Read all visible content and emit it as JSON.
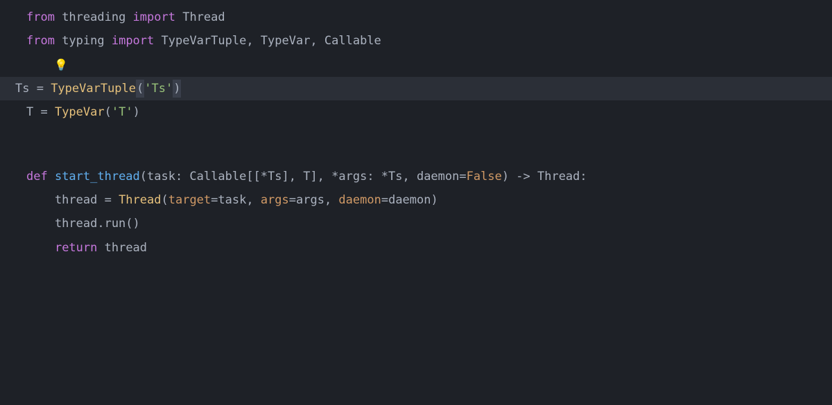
{
  "editor": {
    "language": "python",
    "theme": "dark",
    "highlighted_line_index": 3,
    "lines": [
      {
        "tokens": [
          {
            "t": "from ",
            "c": "keyword"
          },
          {
            "t": "threading ",
            "c": "text"
          },
          {
            "t": "import ",
            "c": "keyword"
          },
          {
            "t": "Thread",
            "c": "text"
          }
        ]
      },
      {
        "tokens": [
          {
            "t": "from ",
            "c": "keyword"
          },
          {
            "t": "typing ",
            "c": "text"
          },
          {
            "t": "import ",
            "c": "keyword"
          },
          {
            "t": "TypeVarTuple, TypeVar, Callable",
            "c": "text"
          }
        ]
      },
      {
        "bulb": true,
        "tokens": []
      },
      {
        "highlighted": true,
        "tokens": [
          {
            "t": "Ts = ",
            "c": "text"
          },
          {
            "t": "TypeVarTuple",
            "c": "call"
          },
          {
            "t": "(",
            "c": "punc",
            "sel": true
          },
          {
            "t": "'Ts'",
            "c": "str"
          },
          {
            "t": ")",
            "c": "punc",
            "sel": true
          }
        ]
      },
      {
        "tokens": [
          {
            "t": "T = ",
            "c": "text"
          },
          {
            "t": "TypeVar",
            "c": "call"
          },
          {
            "t": "(",
            "c": "punc"
          },
          {
            "t": "'T'",
            "c": "str"
          },
          {
            "t": ")",
            "c": "punc"
          }
        ]
      },
      {
        "tokens": []
      },
      {
        "tokens": []
      },
      {
        "tokens": [
          {
            "t": "def ",
            "c": "keyword"
          },
          {
            "t": "start_thread",
            "c": "fname"
          },
          {
            "t": "(task: Calla",
            "c": "text"
          },
          {
            "t": "b",
            "c": "text",
            "cursor": true
          },
          {
            "t": "le[[*Ts], T], *args: *Ts, daemon=",
            "c": "text"
          },
          {
            "t": "False",
            "c": "bool"
          },
          {
            "t": ") -> Thread:",
            "c": "text"
          }
        ]
      },
      {
        "tokens": [
          {
            "t": "    thread = ",
            "c": "text"
          },
          {
            "t": "Thread",
            "c": "call"
          },
          {
            "t": "(",
            "c": "punc"
          },
          {
            "t": "target",
            "c": "param"
          },
          {
            "t": "=task, ",
            "c": "text"
          },
          {
            "t": "args",
            "c": "param"
          },
          {
            "t": "=args, ",
            "c": "text"
          },
          {
            "t": "daemon",
            "c": "param"
          },
          {
            "t": "=daemon)",
            "c": "text"
          }
        ]
      },
      {
        "tokens": [
          {
            "t": "    thread.run()",
            "c": "text"
          }
        ]
      },
      {
        "tokens": [
          {
            "t": "    ",
            "c": "text"
          },
          {
            "t": "return ",
            "c": "keyword"
          },
          {
            "t": "thread",
            "c": "text"
          }
        ]
      }
    ],
    "bulb_glyph": "💡"
  }
}
